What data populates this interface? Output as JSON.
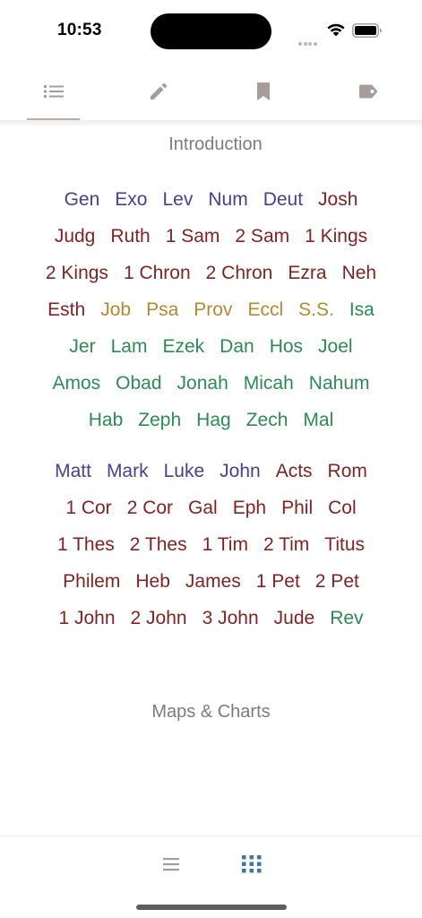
{
  "status_bar": {
    "time": "10:53"
  },
  "top_tabs": [
    {
      "name": "list-icon",
      "selected": true
    },
    {
      "name": "pencil-icon",
      "selected": false
    },
    {
      "name": "bookmark-icon",
      "selected": false
    },
    {
      "name": "tag-icon",
      "selected": false
    }
  ],
  "sections": {
    "introduction": "Introduction",
    "maps_charts": "Maps & Charts"
  },
  "colors": {
    "law_and_gospels": "#4a3f8f",
    "history_and_letters": "#7f2424",
    "poetry": "#b28a33",
    "prophecy": "#2e8a55",
    "inactive_icon": "#a69d98",
    "active_bottom_icon": "#3f78a5"
  },
  "old_testament": [
    [
      {
        "label": "Gen",
        "group": "law_and_gospels"
      },
      {
        "label": "Exo",
        "group": "law_and_gospels"
      },
      {
        "label": "Lev",
        "group": "law_and_gospels"
      },
      {
        "label": "Num",
        "group": "law_and_gospels"
      },
      {
        "label": "Deut",
        "group": "law_and_gospels"
      },
      {
        "label": "Josh",
        "group": "history_and_letters"
      }
    ],
    [
      {
        "label": "Judg",
        "group": "history_and_letters"
      },
      {
        "label": "Ruth",
        "group": "history_and_letters"
      },
      {
        "label": "1 Sam",
        "group": "history_and_letters"
      },
      {
        "label": "2 Sam",
        "group": "history_and_letters"
      },
      {
        "label": "1 Kings",
        "group": "history_and_letters"
      }
    ],
    [
      {
        "label": "2 Kings",
        "group": "history_and_letters"
      },
      {
        "label": "1 Chron",
        "group": "history_and_letters"
      },
      {
        "label": "2 Chron",
        "group": "history_and_letters"
      },
      {
        "label": "Ezra",
        "group": "history_and_letters"
      },
      {
        "label": "Neh",
        "group": "history_and_letters"
      }
    ],
    [
      {
        "label": "Esth",
        "group": "history_and_letters"
      },
      {
        "label": "Job",
        "group": "poetry"
      },
      {
        "label": "Psa",
        "group": "poetry"
      },
      {
        "label": "Prov",
        "group": "poetry"
      },
      {
        "label": "Eccl",
        "group": "poetry"
      },
      {
        "label": "S.S.",
        "group": "poetry"
      },
      {
        "label": "Isa",
        "group": "prophecy"
      }
    ],
    [
      {
        "label": "Jer",
        "group": "prophecy"
      },
      {
        "label": "Lam",
        "group": "prophecy"
      },
      {
        "label": "Ezek",
        "group": "prophecy"
      },
      {
        "label": "Dan",
        "group": "prophecy"
      },
      {
        "label": "Hos",
        "group": "prophecy"
      },
      {
        "label": "Joel",
        "group": "prophecy"
      }
    ],
    [
      {
        "label": "Amos",
        "group": "prophecy"
      },
      {
        "label": "Obad",
        "group": "prophecy"
      },
      {
        "label": "Jonah",
        "group": "prophecy"
      },
      {
        "label": "Micah",
        "group": "prophecy"
      },
      {
        "label": "Nahum",
        "group": "prophecy"
      }
    ],
    [
      {
        "label": "Hab",
        "group": "prophecy"
      },
      {
        "label": "Zeph",
        "group": "prophecy"
      },
      {
        "label": "Hag",
        "group": "prophecy"
      },
      {
        "label": "Zech",
        "group": "prophecy"
      },
      {
        "label": "Mal",
        "group": "prophecy"
      }
    ]
  ],
  "new_testament": [
    [
      {
        "label": "Matt",
        "group": "law_and_gospels"
      },
      {
        "label": "Mark",
        "group": "law_and_gospels"
      },
      {
        "label": "Luke",
        "group": "law_and_gospels"
      },
      {
        "label": "John",
        "group": "law_and_gospels"
      },
      {
        "label": "Acts",
        "group": "history_and_letters"
      },
      {
        "label": "Rom",
        "group": "history_and_letters"
      }
    ],
    [
      {
        "label": "1 Cor",
        "group": "history_and_letters"
      },
      {
        "label": "2 Cor",
        "group": "history_and_letters"
      },
      {
        "label": "Gal",
        "group": "history_and_letters"
      },
      {
        "label": "Eph",
        "group": "history_and_letters"
      },
      {
        "label": "Phil",
        "group": "history_and_letters"
      },
      {
        "label": "Col",
        "group": "history_and_letters"
      }
    ],
    [
      {
        "label": "1 Thes",
        "group": "history_and_letters"
      },
      {
        "label": "2 Thes",
        "group": "history_and_letters"
      },
      {
        "label": "1 Tim",
        "group": "history_and_letters"
      },
      {
        "label": "2 Tim",
        "group": "history_and_letters"
      },
      {
        "label": "Titus",
        "group": "history_and_letters"
      }
    ],
    [
      {
        "label": "Philem",
        "group": "history_and_letters"
      },
      {
        "label": "Heb",
        "group": "history_and_letters"
      },
      {
        "label": "James",
        "group": "history_and_letters"
      },
      {
        "label": "1 Pet",
        "group": "history_and_letters"
      },
      {
        "label": "2 Pet",
        "group": "history_and_letters"
      }
    ],
    [
      {
        "label": "1 John",
        "group": "history_and_letters"
      },
      {
        "label": "2 John",
        "group": "history_and_letters"
      },
      {
        "label": "3 John",
        "group": "history_and_letters"
      },
      {
        "label": "Jude",
        "group": "history_and_letters"
      },
      {
        "label": "Rev",
        "group": "prophecy"
      }
    ]
  ],
  "bottom_tabs": [
    {
      "name": "list-view-icon",
      "selected": false
    },
    {
      "name": "grid-view-icon",
      "selected": true
    }
  ]
}
